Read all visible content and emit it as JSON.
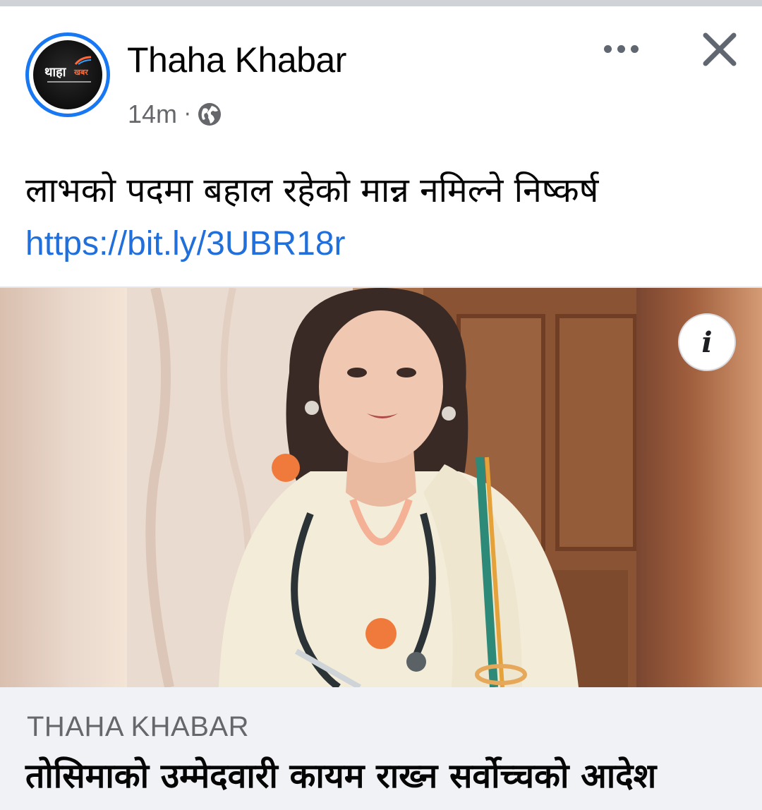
{
  "post": {
    "page_name": "Thaha Khabar",
    "time": "14m",
    "separator": "·",
    "privacy_icon": "globe-icon",
    "avatar_logo_text": "थाहा",
    "avatar_logo_side": "खबर",
    "text": "लाभको पदमा बहाल रहेको मान्न नमिल्ने निष्कर्ष",
    "link": "https://bit.ly/3UBR18r"
  },
  "header_actions": {
    "more_icon": "more-horizontal-icon",
    "close_icon": "close-icon"
  },
  "image": {
    "info_label": "i",
    "description_icon": "photo"
  },
  "link_preview": {
    "source": "THAHA KHABAR",
    "title": "तोसिमाको उम्मेदवारी कायम राख्न सर्वोच्चको आदेश"
  },
  "colors": {
    "accent": "#1877f2",
    "link": "#216fdb",
    "secondary_text": "#65676b",
    "preview_bg": "#f0f2f5"
  }
}
